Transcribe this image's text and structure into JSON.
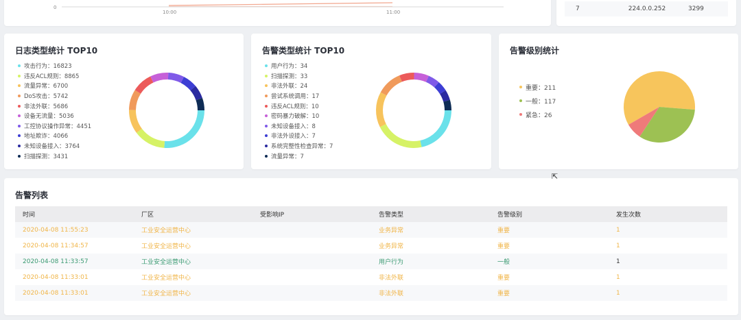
{
  "top_strip": {
    "line_chart": {
      "y_tick": "0",
      "x_ticks": [
        "10:00",
        "11:00"
      ],
      "series_color": "#f2a58c"
    },
    "ip_table": {
      "rows": [
        {
          "rank": "7",
          "ip": "224.0.0.252",
          "count": "3299"
        }
      ]
    }
  },
  "log_types": {
    "title": "日志类型统计 TOP10",
    "items": [
      {
        "label": "攻击行为：16823",
        "value": 16823,
        "color": "#6ae1ea"
      },
      {
        "label": "违反ACL规则：8865",
        "value": 8865,
        "color": "#d6f266"
      },
      {
        "label": "流量异常：6700",
        "value": 6700,
        "color": "#f7c35c"
      },
      {
        "label": "DoS攻击：5742",
        "value": 5742,
        "color": "#f09a5b"
      },
      {
        "label": "非法外联：5686",
        "value": 5686,
        "color": "#ec5a5a"
      },
      {
        "label": "设备无流量：5036",
        "value": 5036,
        "color": "#c660d8"
      },
      {
        "label": "工控协议操作异常：4451",
        "value": 4451,
        "color": "#7f5ae8"
      },
      {
        "label": "地址欺诈：4066",
        "value": 4066,
        "color": "#3d3ed4"
      },
      {
        "label": "未知设备接入：3764",
        "value": 3764,
        "color": "#2a2aa0"
      },
      {
        "label": "扫描探测：3431",
        "value": 3431,
        "color": "#0e2c55"
      }
    ]
  },
  "alert_types": {
    "title": "告警类型统计 TOP10",
    "items": [
      {
        "label": "用户行为：34",
        "value": 34,
        "color": "#6ae1ea"
      },
      {
        "label": "扫描探测：33",
        "value": 33,
        "color": "#d6f266"
      },
      {
        "label": "非法外联：24",
        "value": 24,
        "color": "#f7c35c"
      },
      {
        "label": "尝试系统调用：17",
        "value": 17,
        "color": "#f09a5b"
      },
      {
        "label": "违反ACL规则：10",
        "value": 10,
        "color": "#ec5a5a"
      },
      {
        "label": "密码暴力破解：10",
        "value": 10,
        "color": "#c660d8"
      },
      {
        "label": "未知设备接入：8",
        "value": 8,
        "color": "#7f5ae8"
      },
      {
        "label": "非法外设接入：7",
        "value": 7,
        "color": "#3d3ed4"
      },
      {
        "label": "系统完整性检查异常：7",
        "value": 7,
        "color": "#2a2aa0"
      },
      {
        "label": "流量异常：7",
        "value": 7,
        "color": "#0e2c55"
      }
    ]
  },
  "alert_levels": {
    "title": "告警级别统计",
    "items": [
      {
        "label": "重要：211",
        "value": 211,
        "color": "#f7c55c"
      },
      {
        "label": "一般：117",
        "value": 117,
        "color": "#9dc153"
      },
      {
        "label": "紧急：26",
        "value": 26,
        "color": "#ef7a7a"
      }
    ]
  },
  "alert_list": {
    "title": "告警列表",
    "columns": [
      "时间",
      "厂区",
      "受影响IP",
      "告警类型",
      "告警级别",
      "发生次数"
    ],
    "rows": [
      {
        "time": "2020-04-08 11:55:23",
        "site": "工业安全运营中心",
        "ip": "",
        "type": "业务异常",
        "level": "重要",
        "count": "1",
        "severity": "important"
      },
      {
        "time": "2020-04-08 11:34:57",
        "site": "工业安全运营中心",
        "ip": "",
        "type": "业务异常",
        "level": "重要",
        "count": "1",
        "severity": "important"
      },
      {
        "time": "2020-04-08 11:33:57",
        "site": "工业安全运营中心",
        "ip": "",
        "type": "用户行为",
        "level": "一般",
        "count": "1",
        "severity": "general"
      },
      {
        "time": "2020-04-08 11:33:01",
        "site": "工业安全运营中心",
        "ip": "",
        "type": "非法外联",
        "level": "重要",
        "count": "1",
        "severity": "important"
      },
      {
        "time": "2020-04-08 11:33:01",
        "site": "工业安全运营中心",
        "ip": "",
        "type": "非法外联",
        "level": "重要",
        "count": "1",
        "severity": "important"
      }
    ]
  },
  "chart_data": [
    {
      "type": "pie",
      "title": "日志类型统计 TOP10",
      "categories": [
        "攻击行为",
        "违反ACL规则",
        "流量异常",
        "DoS攻击",
        "非法外联",
        "设备无流量",
        "工控协议操作异常",
        "地址欺诈",
        "未知设备接入",
        "扫描探测"
      ],
      "values": [
        16823,
        8865,
        6700,
        5742,
        5686,
        5036,
        4451,
        4066,
        3764,
        3431
      ]
    },
    {
      "type": "pie",
      "title": "告警类型统计 TOP10",
      "categories": [
        "用户行为",
        "扫描探测",
        "非法外联",
        "尝试系统调用",
        "违反ACL规则",
        "密码暴力破解",
        "未知设备接入",
        "非法外设接入",
        "系统完整性检查异常",
        "流量异常"
      ],
      "values": [
        34,
        33,
        24,
        17,
        10,
        10,
        8,
        7,
        7,
        7
      ]
    },
    {
      "type": "pie",
      "title": "告警级别统计",
      "categories": [
        "重要",
        "一般",
        "紧急"
      ],
      "values": [
        211,
        117,
        26
      ]
    }
  ]
}
